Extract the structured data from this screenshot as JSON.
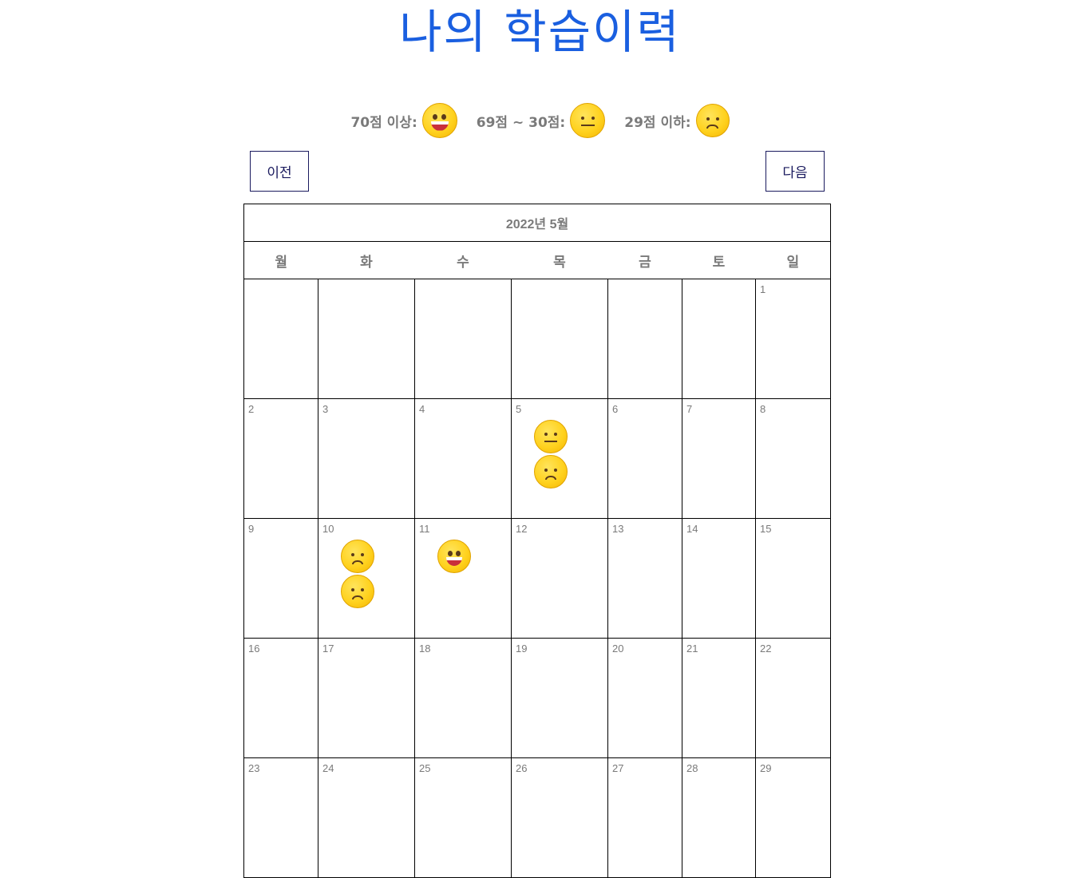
{
  "title": "나의 학습이력",
  "legend": [
    {
      "label": "70점 이상:",
      "icon": "happy-face-icon"
    },
    {
      "label": "69점 ~ 30점:",
      "icon": "neutral-face-icon"
    },
    {
      "label": "29점 이하:",
      "icon": "sad-face-icon"
    }
  ],
  "nav": {
    "prev": "이전",
    "next": "다음"
  },
  "calendar": {
    "month_label": "2022년 5월",
    "weekdays": [
      "월",
      "화",
      "수",
      "목",
      "금",
      "토",
      "일"
    ],
    "weeks": [
      [
        {
          "day": ""
        },
        {
          "day": ""
        },
        {
          "day": ""
        },
        {
          "day": ""
        },
        {
          "day": ""
        },
        {
          "day": ""
        },
        {
          "day": "1"
        }
      ],
      [
        {
          "day": "2"
        },
        {
          "day": "3"
        },
        {
          "day": "4"
        },
        {
          "day": "5",
          "marks": [
            "neutral",
            "sad"
          ]
        },
        {
          "day": "6"
        },
        {
          "day": "7"
        },
        {
          "day": "8"
        }
      ],
      [
        {
          "day": "9"
        },
        {
          "day": "10",
          "marks": [
            "sad",
            "sad"
          ]
        },
        {
          "day": "11",
          "marks": [
            "happy"
          ]
        },
        {
          "day": "12"
        },
        {
          "day": "13"
        },
        {
          "day": "14"
        },
        {
          "day": "15"
        }
      ],
      [
        {
          "day": "16"
        },
        {
          "day": "17"
        },
        {
          "day": "18"
        },
        {
          "day": "19"
        },
        {
          "day": "20"
        },
        {
          "day": "21"
        },
        {
          "day": "22"
        }
      ],
      [
        {
          "day": "23"
        },
        {
          "day": "24"
        },
        {
          "day": "25"
        },
        {
          "day": "26"
        },
        {
          "day": "27"
        },
        {
          "day": "28"
        },
        {
          "day": "29"
        }
      ]
    ]
  },
  "colors": {
    "title": "#1a5fe0",
    "button_border": "#1a1a5e",
    "muted_text": "#7a7a7a"
  }
}
